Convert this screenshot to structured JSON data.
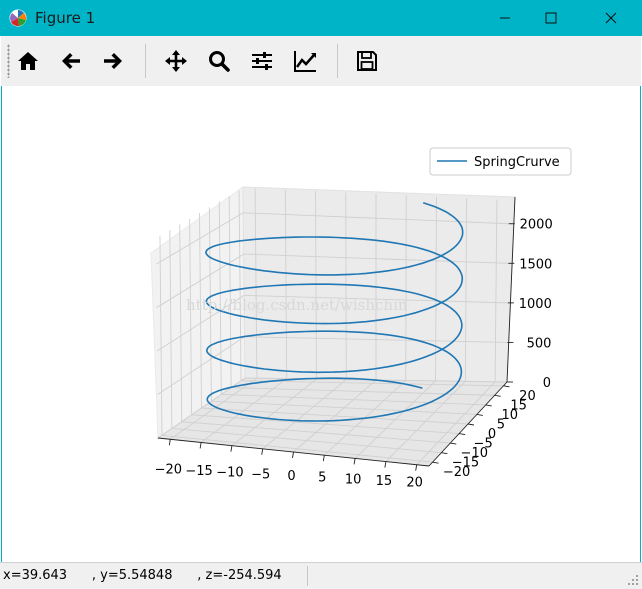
{
  "window": {
    "title": "Figure 1"
  },
  "toolbar": {
    "buttons": [
      {
        "name": "home",
        "icon": "home-icon"
      },
      {
        "name": "back",
        "icon": "arrow-left-icon"
      },
      {
        "name": "forward",
        "icon": "arrow-right-icon"
      },
      {
        "name": "pan",
        "icon": "move-icon"
      },
      {
        "name": "zoom",
        "icon": "magnifier-icon"
      },
      {
        "name": "subplots",
        "icon": "sliders-icon"
      },
      {
        "name": "edit-axes",
        "icon": "line-chart-icon"
      },
      {
        "name": "save",
        "icon": "floppy-disk-icon"
      }
    ]
  },
  "status": {
    "coords": "x=39.643      , y=5.54848      , z=-254.594"
  },
  "watermark": "http://blog.csdn.net/wishchin",
  "colors": {
    "titlebar": "#00b4c8",
    "series": "#1f77b4",
    "toolbar_bg": "#f0f0f0"
  },
  "chart_data": {
    "type": "line",
    "projection": "3d",
    "series": [
      {
        "name": "SpringCrurve",
        "x_equation": "x = 20*cos(t)",
        "y_equation": "y = 20*sin(t)",
        "z_range": [
          0,
          2300
        ],
        "turns": 4
      }
    ],
    "x_ticks": [
      "−20",
      "−15",
      "−10",
      "−5",
      "0",
      "5",
      "10",
      "15",
      "20"
    ],
    "y_ticks": [
      "−20",
      "−15",
      "−10",
      "−5",
      "0",
      "5",
      "10",
      "15",
      "20"
    ],
    "z_ticks": [
      "0",
      "500",
      "1000",
      "1500",
      "2000"
    ],
    "xlim": [
      -22,
      22
    ],
    "ylim": [
      -22,
      22
    ],
    "zlim": [
      0,
      2300
    ],
    "legend": "top-right",
    "grid": true
  }
}
